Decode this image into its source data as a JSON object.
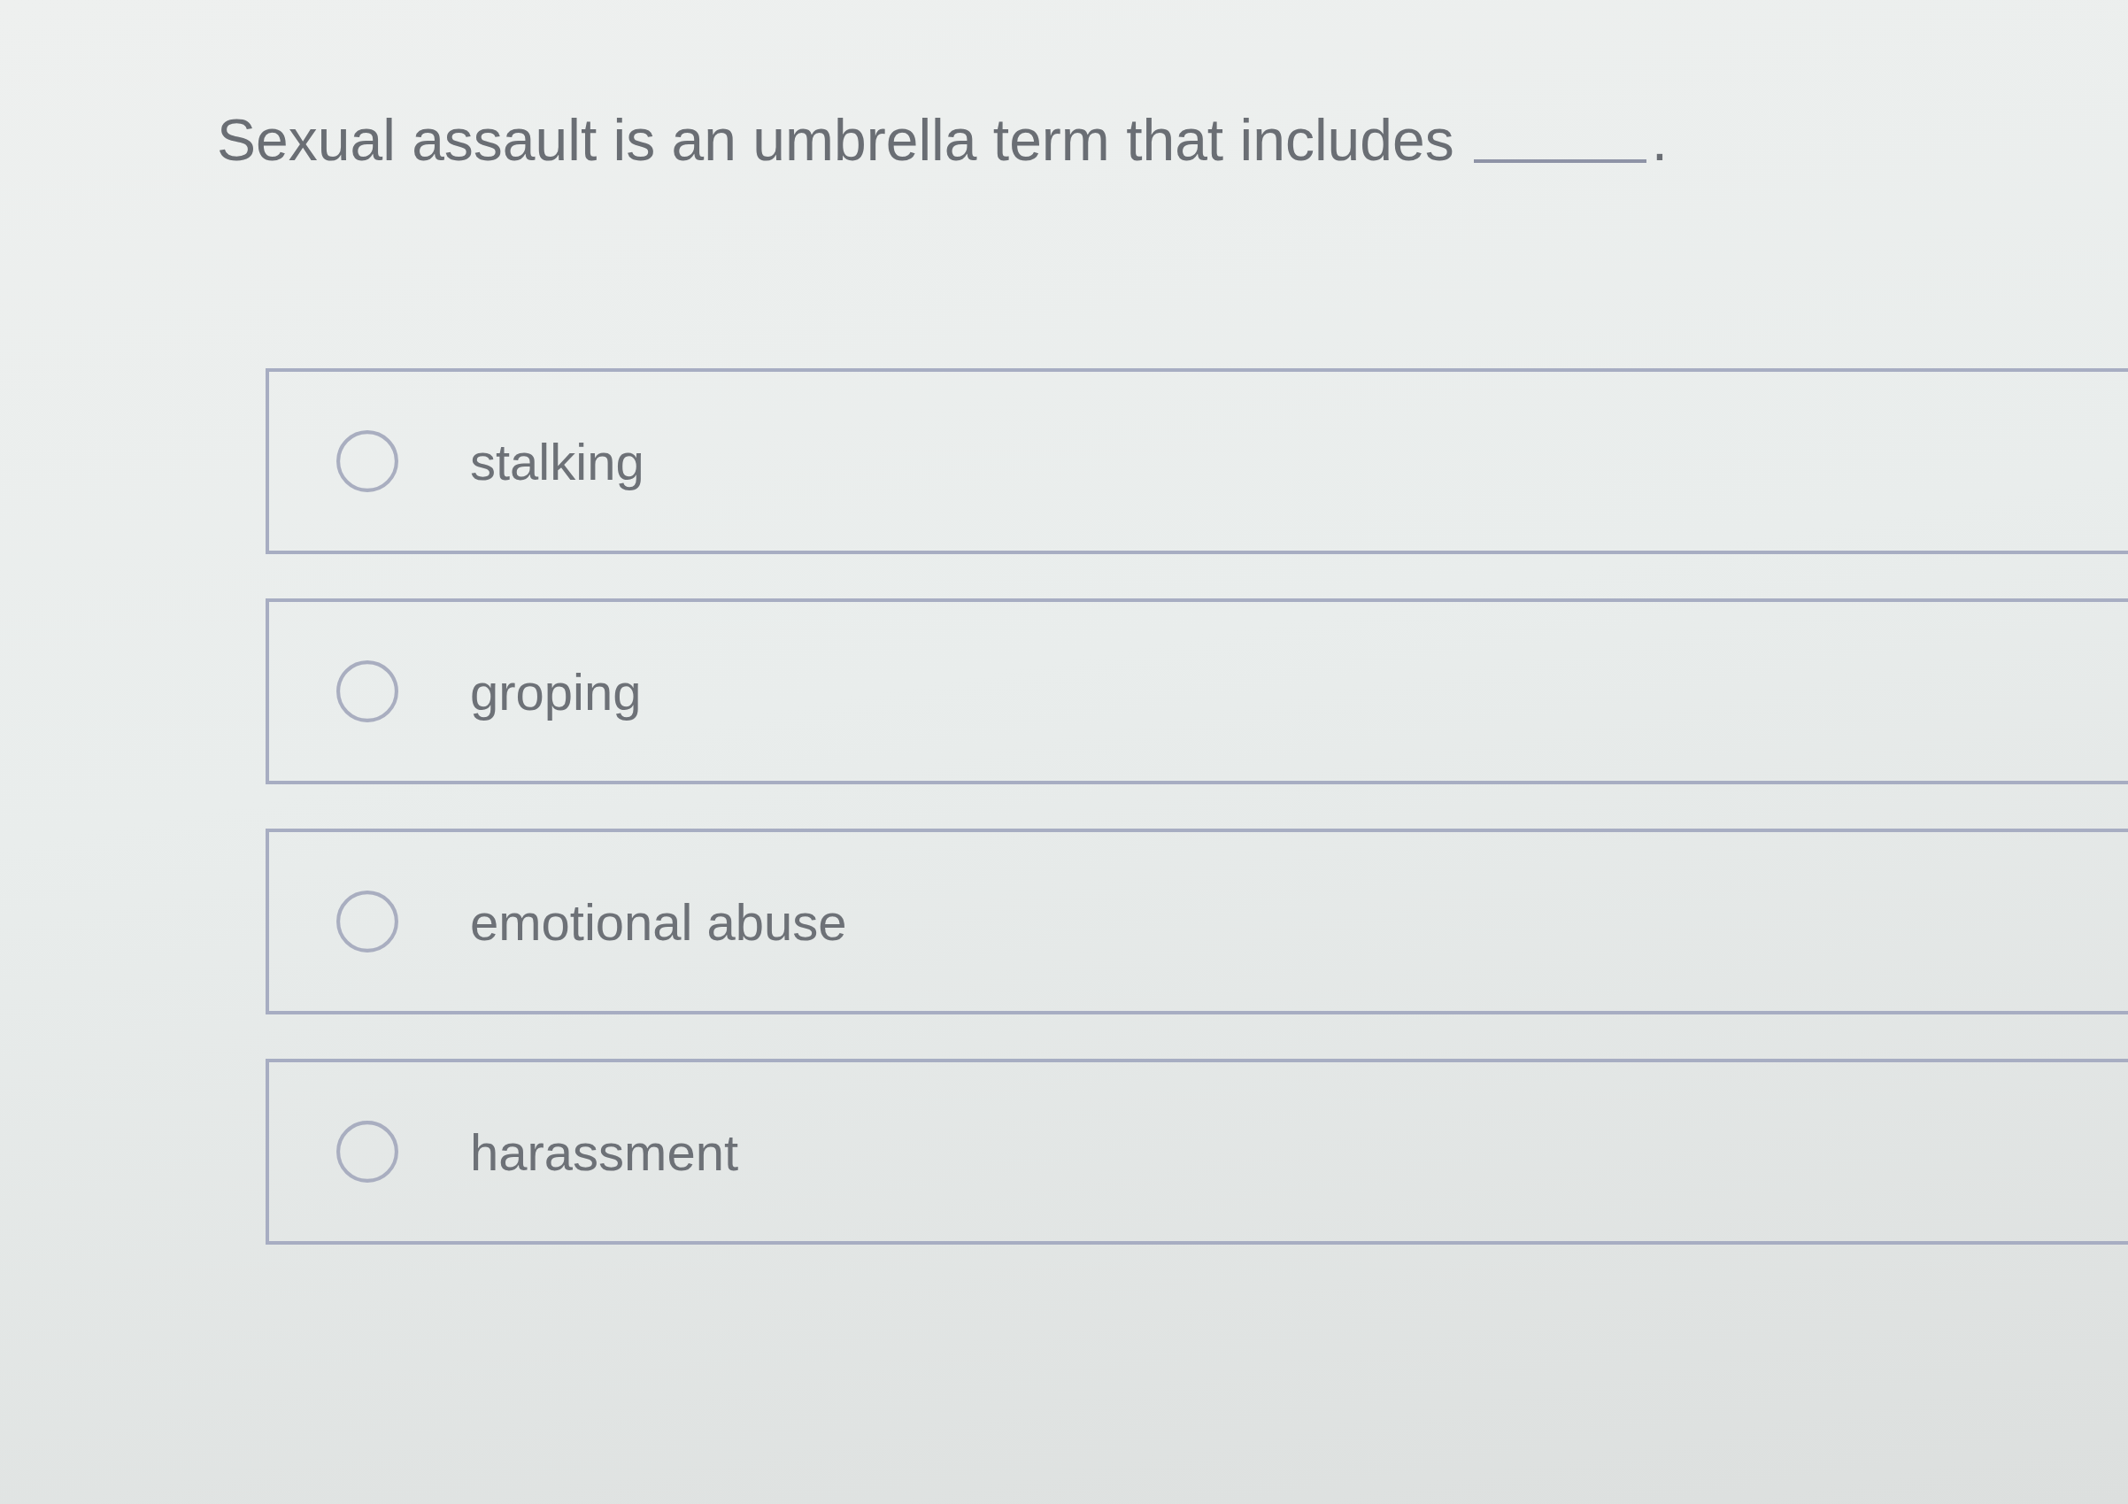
{
  "question": {
    "text": "Sexual assault is an umbrella term that includes",
    "after_blank": "."
  },
  "options": [
    {
      "label": "stalking",
      "selected": false
    },
    {
      "label": "groping",
      "selected": false
    },
    {
      "label": "emotional abuse",
      "selected": false
    },
    {
      "label": "harassment",
      "selected": false
    }
  ]
}
